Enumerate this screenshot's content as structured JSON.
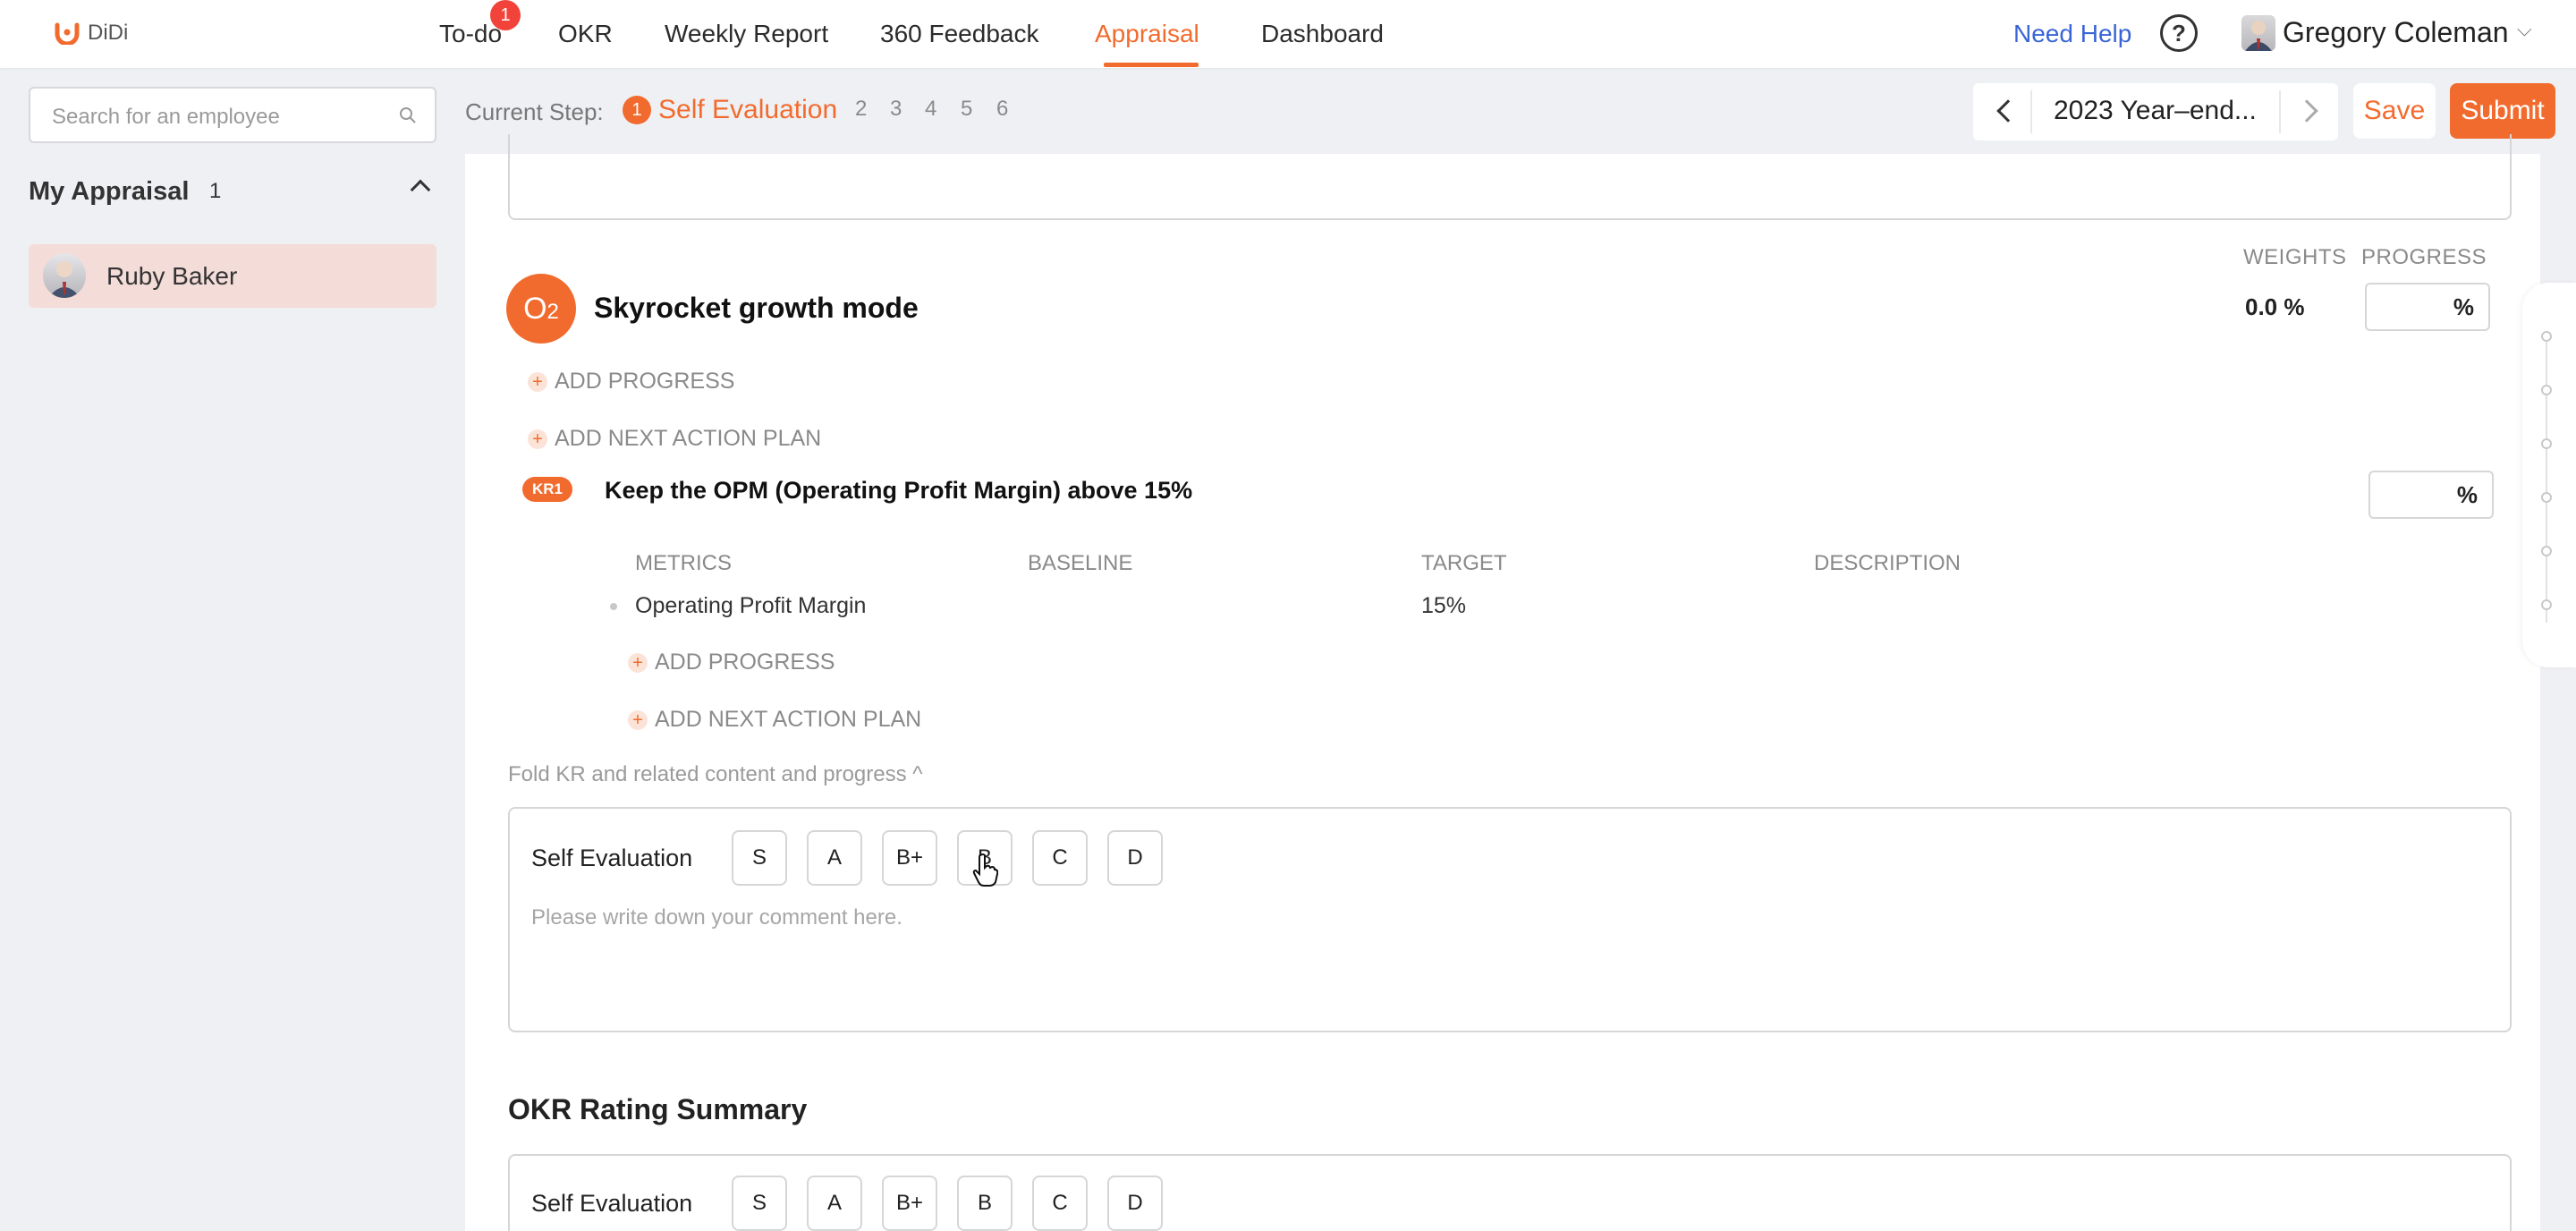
{
  "app": {
    "logo_text": "DiDi",
    "brand_color": "#f26b2e"
  },
  "nav": {
    "items": [
      {
        "label": "To-do",
        "badge": "1"
      },
      {
        "label": "OKR"
      },
      {
        "label": "Weekly Report"
      },
      {
        "label": "360 Feedback"
      },
      {
        "label": "Appraisal",
        "active": true
      },
      {
        "label": "Dashboard"
      }
    ],
    "help": "Need Help",
    "help_icon": "?",
    "user": "Gregory Coleman"
  },
  "sidebar": {
    "search_placeholder": "Search for an employee",
    "section_title": "My Appraisal",
    "section_count": "1",
    "employees": [
      {
        "name": "Ruby Baker"
      }
    ]
  },
  "steps": {
    "label": "Current Step:",
    "current_num": "1",
    "current_name": "Self Evaluation",
    "others": [
      "2",
      "3",
      "4",
      "5",
      "6"
    ]
  },
  "period": {
    "text": "2023 Year–end...",
    "save": "Save",
    "submit": "Submit"
  },
  "objective": {
    "badge_letter": "O",
    "badge_num": "2",
    "title": "Skyrocket growth mode",
    "weights_label": "WEIGHTS",
    "progress_label": "PROGRESS",
    "weight": "0.0 %",
    "progress_suffix": "%",
    "add_progress": "ADD PROGRESS",
    "add_next": "ADD NEXT ACTION PLAN"
  },
  "kr": {
    "badge": "KR1",
    "title": "Keep the OPM (Operating Profit Margin) above 15%",
    "progress_suffix": "%",
    "headers": [
      "METRICS",
      "BASELINE",
      "TARGET",
      "DESCRIPTION"
    ],
    "row": {
      "metric": "Operating Profit Margin",
      "baseline": "",
      "target": "15%",
      "description": ""
    },
    "add_progress": "ADD PROGRESS",
    "add_next": "ADD NEXT ACTION PLAN"
  },
  "fold_text": "Fold KR and related content and progress ^",
  "self_eval": {
    "label": "Self Evaluation",
    "grades": [
      "S",
      "A",
      "B+",
      "B",
      "C",
      "D"
    ],
    "comment_placeholder": "Please write down your comment here."
  },
  "summary": {
    "title": "OKR Rating Summary",
    "label": "Self Evaluation",
    "grades": [
      "S",
      "A",
      "B+",
      "B",
      "C",
      "D"
    ]
  }
}
